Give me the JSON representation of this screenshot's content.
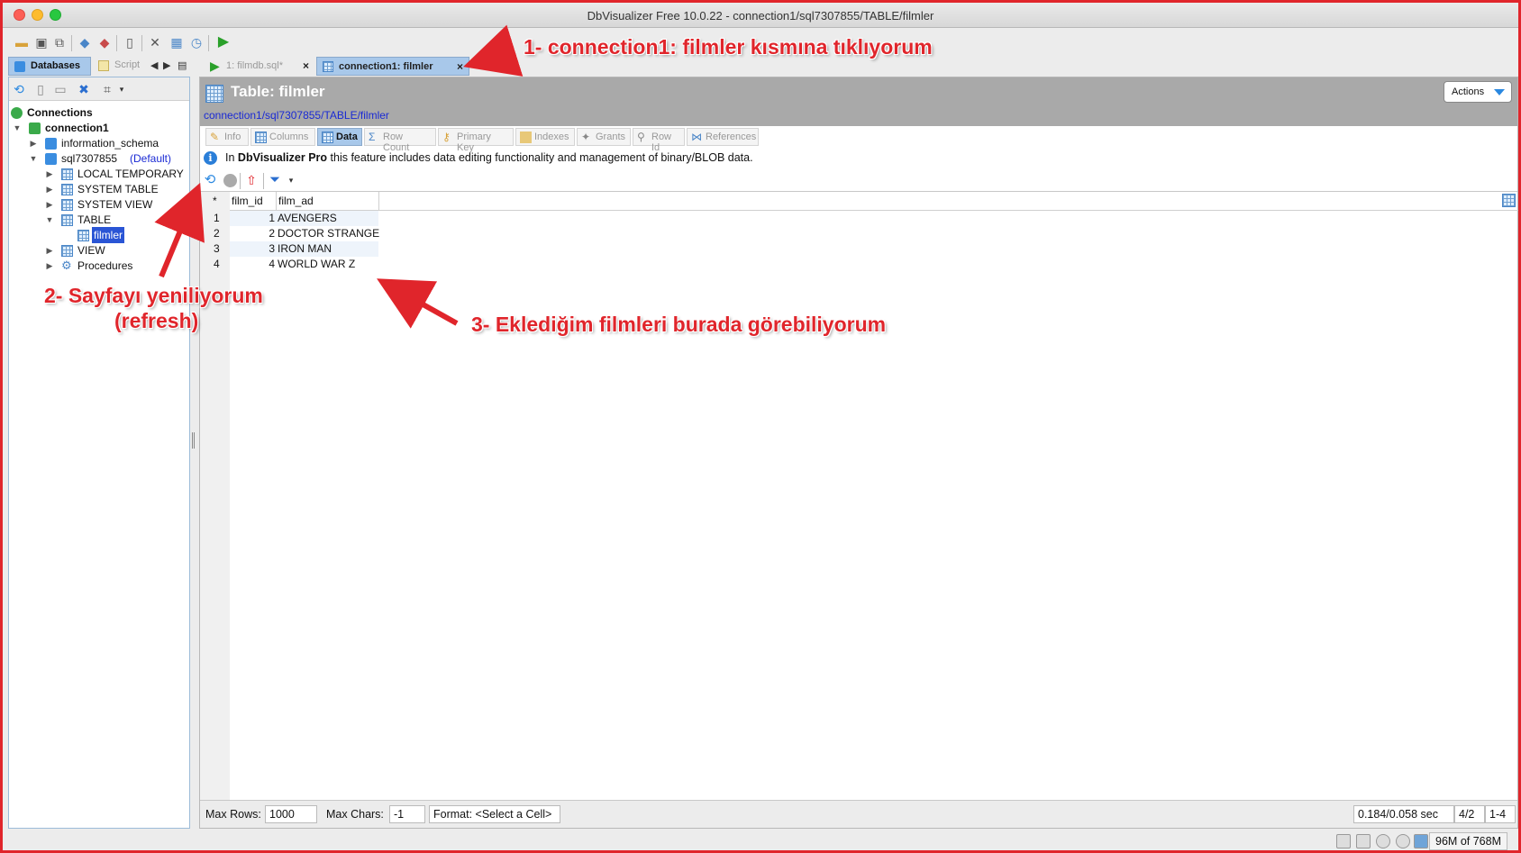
{
  "window": {
    "title": "DbVisualizer Free 10.0.22 - connection1/sql7307855/TABLE/filmler"
  },
  "left_tabs": {
    "databases": "Databases",
    "scripts": "Script"
  },
  "tree": {
    "root": "Connections",
    "connection": "connection1",
    "schema1": "information_schema",
    "schema2": "sql7307855",
    "schema2_default": "(Default)",
    "local_temporary": "LOCAL TEMPORARY",
    "system_table": "SYSTEM TABLE",
    "system_view": "SYSTEM VIEW",
    "table": "TABLE",
    "table_item": "filmler",
    "view": "VIEW",
    "procedures": "Procedures"
  },
  "editor_tabs": {
    "tab1": "1: filmdb.sql*",
    "tab2": "connection1: filmler"
  },
  "object_header": {
    "title": "Table: filmler",
    "path": "connection1/sql7307855/TABLE/filmler",
    "actions": "Actions"
  },
  "subtabs": [
    "Info",
    "Columns",
    "Data",
    "Row Count",
    "Primary Key",
    "Indexes",
    "Grants",
    "Row Id",
    "References"
  ],
  "info": {
    "prefix": "In",
    "product": "DbVisualizer Pro",
    "message": "this feature includes data editing functionality and management of binary/BLOB data."
  },
  "grid": {
    "corner": "*",
    "columns": [
      "film_id",
      "film_ad"
    ],
    "rows": [
      {
        "n": "1",
        "film_id": "1",
        "film_ad": "AVENGERS"
      },
      {
        "n": "2",
        "film_id": "2",
        "film_ad": "DOCTOR STRANGE"
      },
      {
        "n": "3",
        "film_id": "3",
        "film_ad": "IRON MAN"
      },
      {
        "n": "4",
        "film_id": "4",
        "film_ad": "WORLD WAR Z"
      }
    ]
  },
  "status": {
    "max_rows_label": "Max Rows:",
    "max_rows": "1000",
    "max_chars_label": "Max Chars:",
    "max_chars": "-1",
    "format": "Format: <Select a Cell>",
    "timing": "0.184/0.058 sec",
    "pos": "4/2",
    "range": "1-4"
  },
  "memory": "96M of 768M",
  "annotations": {
    "a1": "1- connection1: filmler kısmına tıklıyorum",
    "a2_line1": "2- Sayfayı yeniliyorum",
    "a2_line2": "(refresh)",
    "a3": "3- Eklediğim filmleri burada görebiliyorum"
  },
  "colors": {
    "annotation": "#e0252b",
    "selection": "#2a55d5",
    "active_tab": "#a8c8ea"
  }
}
